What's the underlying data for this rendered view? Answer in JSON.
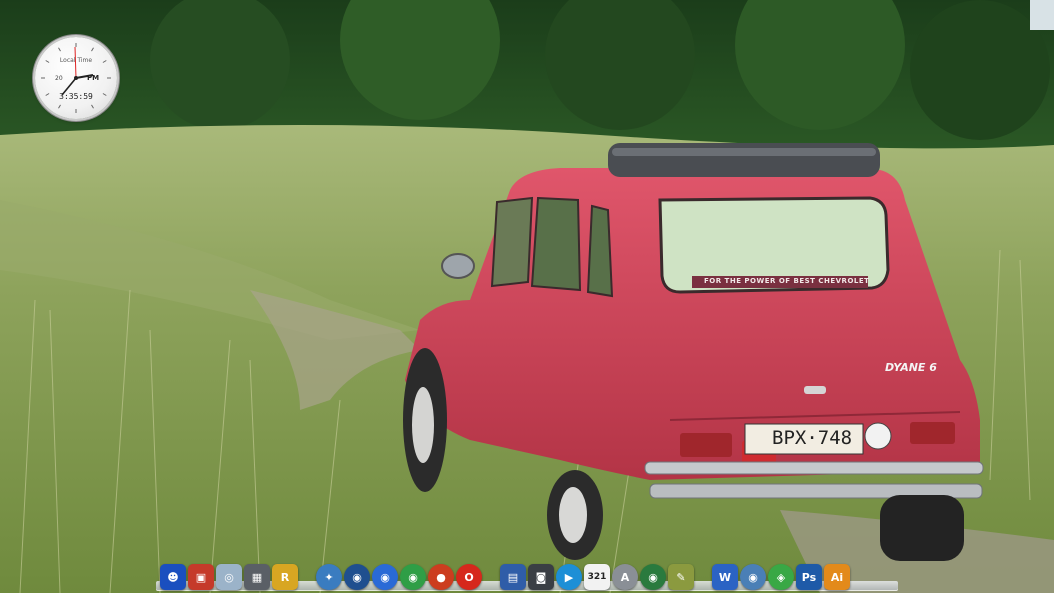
{
  "desktop": {
    "wallpaper": {
      "plate_text": "BPX·748",
      "badge_text": "DYANE 6",
      "window_sticker": "FOR THE POWER OF BEST CHEVROLET",
      "car_color": "#d5475d"
    }
  },
  "clock_widget": {
    "title": "Local Time",
    "date": "20",
    "ampm": "PM",
    "time": "3:35:59"
  },
  "dock": {
    "items": [
      {
        "name": "finder-icon",
        "glyph": "☻",
        "bg": "#1a4fbf"
      },
      {
        "name": "photo-booth-icon",
        "glyph": "▣",
        "bg": "#c53a2a"
      },
      {
        "name": "preview-icon",
        "glyph": "◎",
        "bg": "#9bb3c9"
      },
      {
        "name": "calculator-icon",
        "glyph": "▦",
        "bg": "#5a5f66"
      },
      {
        "name": "r-app-icon",
        "glyph": "R",
        "bg": "#d8a622"
      },
      {
        "name": "network-icon",
        "glyph": "✦",
        "bg": "#3a7cc0"
      },
      {
        "name": "globe-icon",
        "glyph": "◉",
        "bg": "#1f4f8f"
      },
      {
        "name": "safari-icon",
        "glyph": "◉",
        "bg": "#2a6ad6"
      },
      {
        "name": "browser-green-icon",
        "glyph": "◉",
        "bg": "#2f9e46"
      },
      {
        "name": "ball-icon",
        "glyph": "●",
        "bg": "#cc3d1f"
      },
      {
        "name": "opera-icon",
        "glyph": "O",
        "bg": "#d6281c"
      },
      {
        "name": "floppy-save-icon",
        "glyph": "▤",
        "bg": "#2f5da8"
      },
      {
        "name": "camera-icon",
        "glyph": "◙",
        "bg": "#3a3e44"
      },
      {
        "name": "play-icon",
        "glyph": "▶",
        "bg": "#1d8fd6"
      },
      {
        "name": "calendar-icon",
        "glyph": "321",
        "bg": "#f2f2f2",
        "color": "#222"
      },
      {
        "name": "app-store-icon",
        "glyph": "A",
        "bg": "#8a8f96"
      },
      {
        "name": "earth-icon",
        "glyph": "◉",
        "bg": "#2a7a3e"
      },
      {
        "name": "tools-icon",
        "glyph": "✎",
        "bg": "#8b9a3f"
      },
      {
        "name": "word-icon",
        "glyph": "W",
        "bg": "#2b63c4"
      },
      {
        "name": "sync-icon",
        "glyph": "◉",
        "bg": "#4a7fb6"
      },
      {
        "name": "leaf-icon",
        "glyph": "◈",
        "bg": "#39a845"
      },
      {
        "name": "photoshop-icon",
        "glyph": "Ps",
        "bg": "#1e5aa8"
      },
      {
        "name": "illustrator-icon",
        "glyph": "Ai",
        "bg": "#e38a1a"
      }
    ]
  }
}
